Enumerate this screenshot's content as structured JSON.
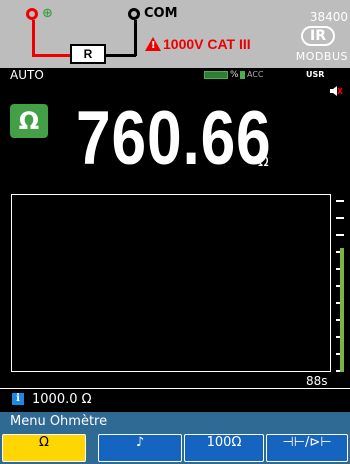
{
  "banner": {
    "terminal_plus_label": "⊕",
    "terminal_com_label": "COM",
    "resistor_label": "R",
    "category_label": "1000V CAT III",
    "baud_rate": "38400",
    "ir_label": "IR",
    "protocol_label": "MODBUS"
  },
  "status": {
    "range_mode": "AUTO",
    "battery_percent": "%",
    "acc_label": "ACC",
    "usr_label": "USR"
  },
  "measurement": {
    "function_symbol": "Ω",
    "value": "760.66",
    "unit": "Ω"
  },
  "graph": {
    "time_span": "88s",
    "level_fraction": 0.72
  },
  "info": {
    "icon": "i",
    "value": "1000.0 Ω"
  },
  "menu": {
    "title": "Menu Ohmètre",
    "softkeys": [
      {
        "label": "Ω",
        "active": true
      },
      {
        "label": "♪",
        "active": false
      },
      {
        "label": "100Ω",
        "active": false
      },
      {
        "label": "⊣⊢/⊳⊢",
        "active": false
      }
    ]
  },
  "colors": {
    "banner_bg": "#bdbdbd",
    "wire_red": "#e00000",
    "terminal_green": "#43a047",
    "menu_bg": "#2f6a95",
    "softkey_active": "#ffd600",
    "softkey_bg": "#1565c0"
  }
}
